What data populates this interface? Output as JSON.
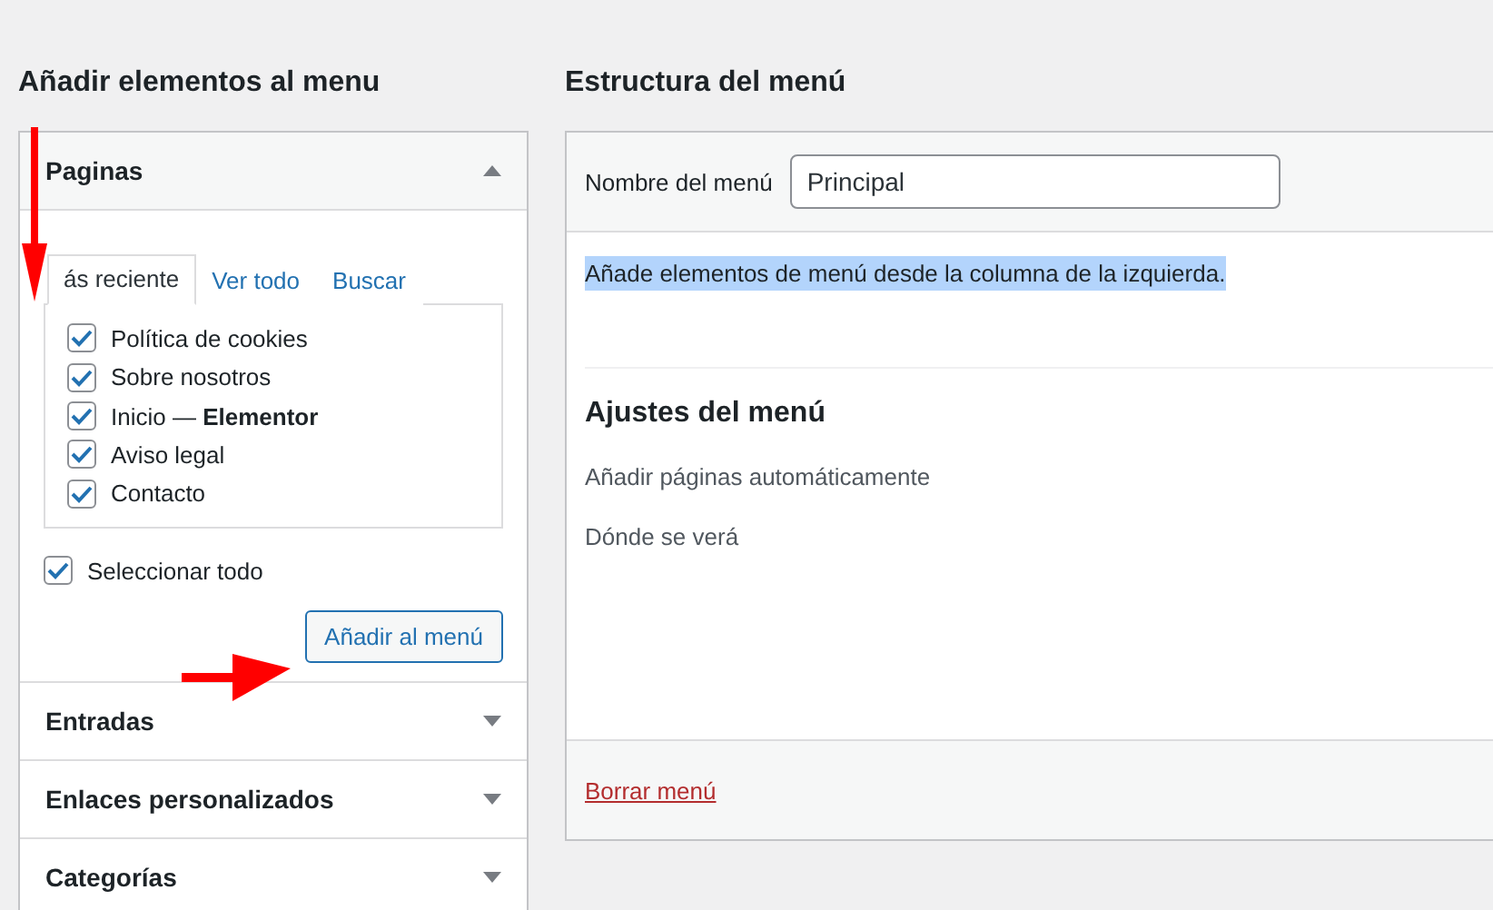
{
  "left_heading": "Añadir elementos al menu",
  "sections": [
    {
      "title": "Paginas",
      "expanded": true
    },
    {
      "title": "Entradas",
      "expanded": false
    },
    {
      "title": "Enlaces personalizados",
      "expanded": false
    },
    {
      "title": "Categorías",
      "expanded": false
    }
  ],
  "tabs": [
    {
      "label": "ás reciente",
      "selected": true
    },
    {
      "label": "Ver todo",
      "selected": false
    },
    {
      "label": "Buscar",
      "selected": false
    }
  ],
  "pages": [
    {
      "label": "Política de cookies",
      "checked": true
    },
    {
      "label": "Sobre nosotros",
      "checked": true
    },
    {
      "label": "Inicio — **Elementor**",
      "checked": true
    },
    {
      "label": "Aviso legal",
      "checked": true
    },
    {
      "label": "Contacto",
      "checked": true
    }
  ],
  "select_all": {
    "label": "Seleccionar todo",
    "checked": true
  },
  "add_button": "Añadir al menú",
  "right_heading": "Estructura del menú",
  "menu_name": {
    "label": "Nombre del menú",
    "value": "Principal"
  },
  "instructions": {
    "text": "Añade elementos de menú desde la columna de la izquierda.",
    "highlighted": true
  },
  "settings": {
    "title": "Ajustes del menú",
    "options": [
      "Añadir páginas automáticamente",
      "Dónde se verá"
    ]
  },
  "delete_link": "Borrar menú"
}
